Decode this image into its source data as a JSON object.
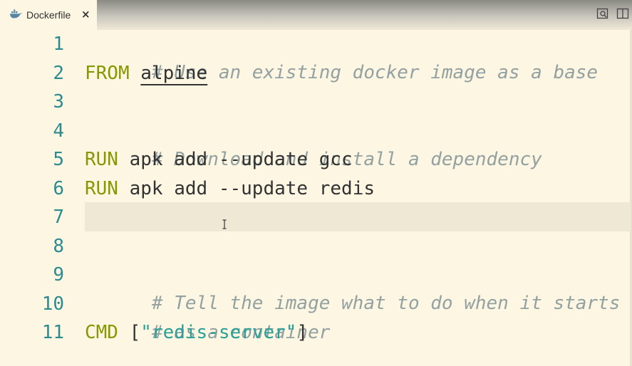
{
  "tab": {
    "label": "Dockerfile",
    "close_glyph": "×",
    "icon": "docker-whale-icon"
  },
  "actions": {
    "icons": [
      "open-preview-icon",
      "split-editor-icon"
    ]
  },
  "colors": {
    "background": "#fdf6e3",
    "line_number": "#2d8b8f",
    "comment": "#93a1a1",
    "keyword": "#859900",
    "string": "#2aa198",
    "text": "#323232",
    "current_line": "#eee8d5"
  },
  "editor": {
    "lines": [
      {
        "number": "1",
        "comment": "# Use an existing docker image as a base"
      },
      {
        "number": "2",
        "keyword": "FROM",
        "arg": "alpine"
      },
      {
        "number": "3"
      },
      {
        "number": "4",
        "comment": "# Download and install a dependency"
      },
      {
        "number": "5",
        "keyword": "RUN",
        "arg": "apk add --update gcc"
      },
      {
        "number": "6",
        "keyword": "RUN",
        "arg": "apk add --update redis"
      },
      {
        "number": "7"
      },
      {
        "number": "8"
      },
      {
        "number": "9",
        "comment": "# Tell the image what to do when it starts"
      },
      {
        "number": "10",
        "comment": "# as a container"
      },
      {
        "number": "11",
        "keyword": "CMD",
        "open": "[",
        "string": "\"redis-server\"",
        "close": "]"
      }
    ]
  }
}
